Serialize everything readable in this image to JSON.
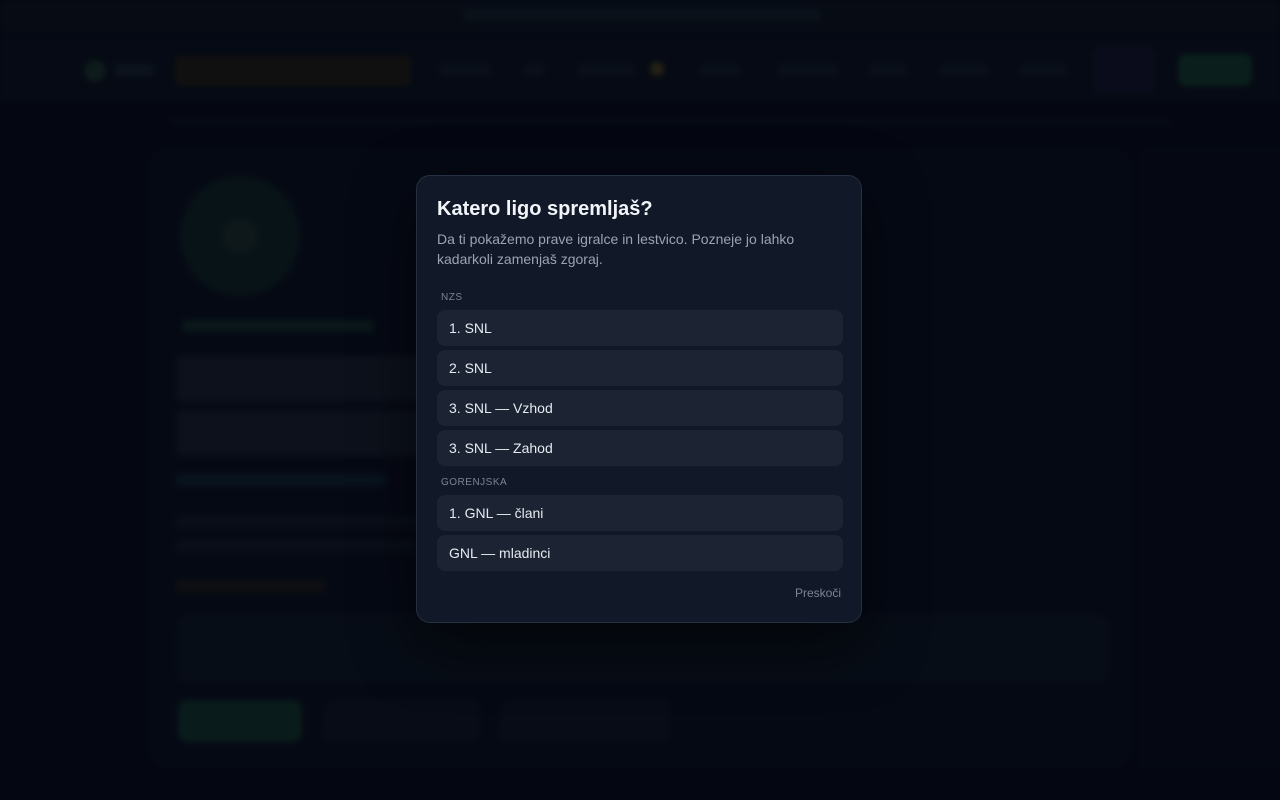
{
  "modal": {
    "title": "Katero ligo spremljaš?",
    "subtitle": "Da ti pokažemo prave igralce in lestvico. Pozneje jo lahko kadarkoli zamenjaš zgoraj.",
    "groups": [
      {
        "label": "NZS",
        "options": [
          "1. SNL",
          "2. SNL",
          "3. SNL — Vzhod",
          "3. SNL — Zahod"
        ]
      },
      {
        "label": "Gorenjska",
        "options": [
          "1. GNL — člani",
          "GNL — mladinci"
        ]
      }
    ],
    "skip_label": "Preskoči"
  },
  "colors": {
    "modal_bg": "#111827",
    "option_bg": "#1c2333",
    "accent_green": "#1e6b3f"
  }
}
